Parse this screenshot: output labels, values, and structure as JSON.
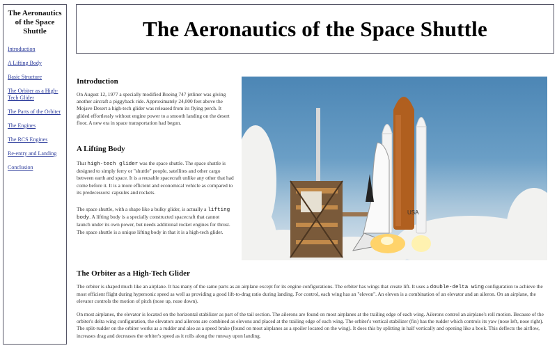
{
  "sidebar": {
    "title": "The Aeronautics of the Space Shuttle",
    "links": [
      {
        "label": "Introduction"
      },
      {
        "label": "A Lifting Body"
      },
      {
        "label": "Basic Structure"
      },
      {
        "label": "The Orbiter as a High-Tech Glider"
      },
      {
        "label": "The Parts of the Orbiter"
      },
      {
        "label": "The Engines"
      },
      {
        "label": "The RCS Engines"
      },
      {
        "label": "Re-entry and Landing"
      },
      {
        "label": "Conclusion"
      }
    ]
  },
  "header": {
    "title": "The Aeronautics of the Space Shuttle"
  },
  "intro": {
    "heading": "Introduction",
    "text": "On August 12, 1977 a specially modified Boeing 747 jetliner was giving another aircraft a piggyback ride. Approximately 24,000 feet above the Mojave Desert a high-tech glider was released from its flying perch. It glided effortlessly without engine power to a smooth landing on the desert floor. A new era in space transportation had begun."
  },
  "lifting_body": {
    "heading": "A Lifting Body",
    "p1_before": "That ",
    "p1_code": "high-tech glider",
    "p1_after": " was the space shuttle. The space shuttle is designed to simply ferry or \"shuttle\" people, satellites and other cargo between earth and space. It is a reusable spacecraft unlike any other that had come before it. It is a more efficient and economical vehicle as compared to its predecessors: capsules and rockets.",
    "p2_before": "The space shuttle, with a shape like a bulky glider, is actually a ",
    "p2_code": "lifting body",
    "p2_after": ". A lifting body is a specially constructed spacecraft that cannot launch under its own power, but needs additional rocket engines for thrust. The space shuttle is a unique lifting body in that it is a high-tech glider."
  },
  "photo": {
    "label": "USA"
  },
  "orbiter": {
    "heading": "The Orbiter as a High-Tech Glider",
    "p1_before": "The orbiter is shaped much like an airplane. It has many of the same parts as an airplane except for its engine configurations. The orbiter has wings that create lift. It uses a ",
    "p1_code": "double-delta wing",
    "p1_after": " configuration to achieve the most efficient flight during hypersonic speed as well as providing a good lift-to-drag ratio during landing. For control, each wing has an \"elevon\". An elevon is a combination of an elevator and an aileron. On an airplane, the elevator controls the motion of pitch (nose up, nose down).",
    "p2": "On most airplanes, the elevator is located on the horizontal stabilizer as part of the tail section. The ailerons are found on most airplanes at the trailing edge of each wing. Ailerons control an airplane's roll motion. Because of the orbiter's delta wing configuration, the elevators and ailerons are combined as elevons and placed at the trailing edge of each wing. The orbiter's vertical stabilizer (fin) has the rudder which controls its yaw (nose left, nose right). The split-rudder on the orbiter works as a rudder and also as a speed brake (found on most airplanes as a spoiler located on the wing). It does this by splitting in half vertically and opening like a book. This deflects the airflow, increases drag and decreases the orbiter's speed as it rolls along the runway upon landing."
  }
}
